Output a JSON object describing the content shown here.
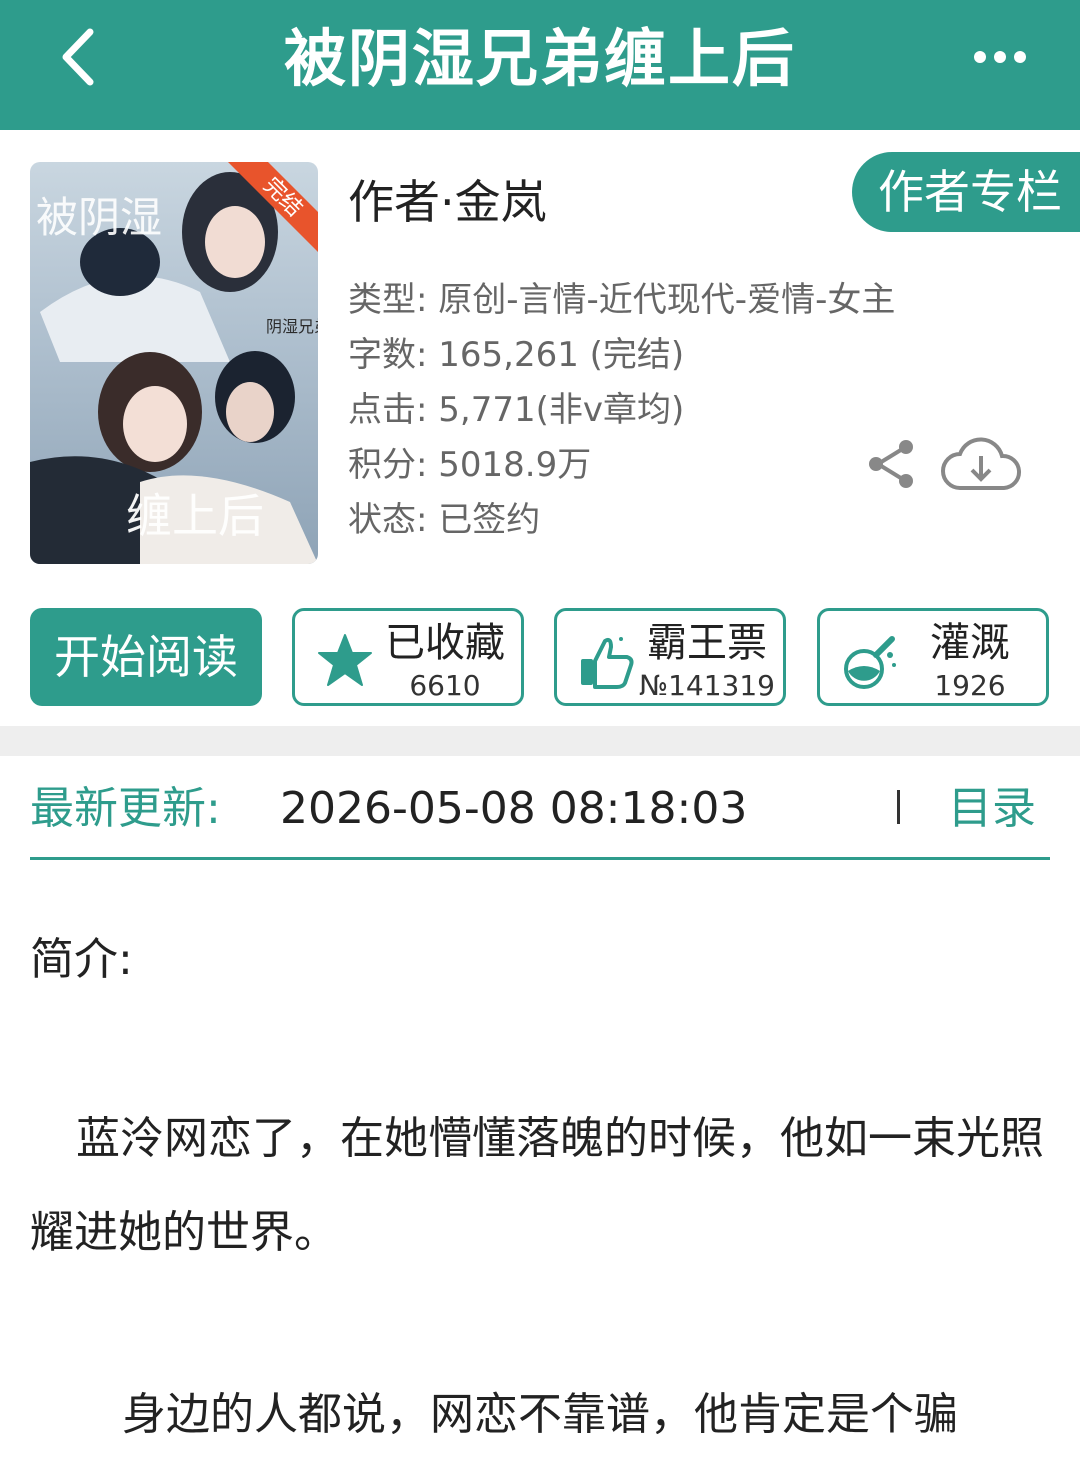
{
  "header": {
    "title": "被阴湿兄弟缠上后",
    "back_icon": "chevron-left-icon",
    "more_icon": "more-dots-icon"
  },
  "book": {
    "cover": {
      "status_ribbon": "完结",
      "title_art": "被阴湿兄弟缠上后",
      "small_text": "阴湿兄弟"
    },
    "author": "作者·金岚",
    "author_column_label": "作者专栏",
    "meta": {
      "genre": "类型: 原创-言情-近代现代-爱情-女主",
      "words": "字数: 165,261 (完结)",
      "clicks": "点击: 5,771(非v章均)",
      "points": "积分: 5018.9万",
      "status": "状态: 已签约"
    }
  },
  "actions": {
    "read_label": "开始阅读",
    "favorite": {
      "label": "已收藏",
      "count": "6610",
      "icon": "star-icon"
    },
    "vote": {
      "label": "霸王票",
      "count": "№141319",
      "icon": "thumbs-up-icon"
    },
    "water": {
      "label": "灌溉",
      "count": "1926",
      "icon": "flask-icon"
    },
    "share_icon": "share-icon",
    "download_icon": "cloud-download-icon"
  },
  "update": {
    "label": "最新更新:",
    "datetime": "2026-05-08 08:18:03",
    "toc_label": "目录"
  },
  "intro": {
    "label": "简介:",
    "paragraphs": [
      "蓝泠网恋了，在她懵懂落魄的时候，他如一束光照耀进她的世界。",
      "身边的人都说，网恋不靠谱，他肯定是个骗"
    ]
  },
  "colors": {
    "accent": "#2e9c8c",
    "background": "#ffffff",
    "separator": "#eeeeee"
  }
}
